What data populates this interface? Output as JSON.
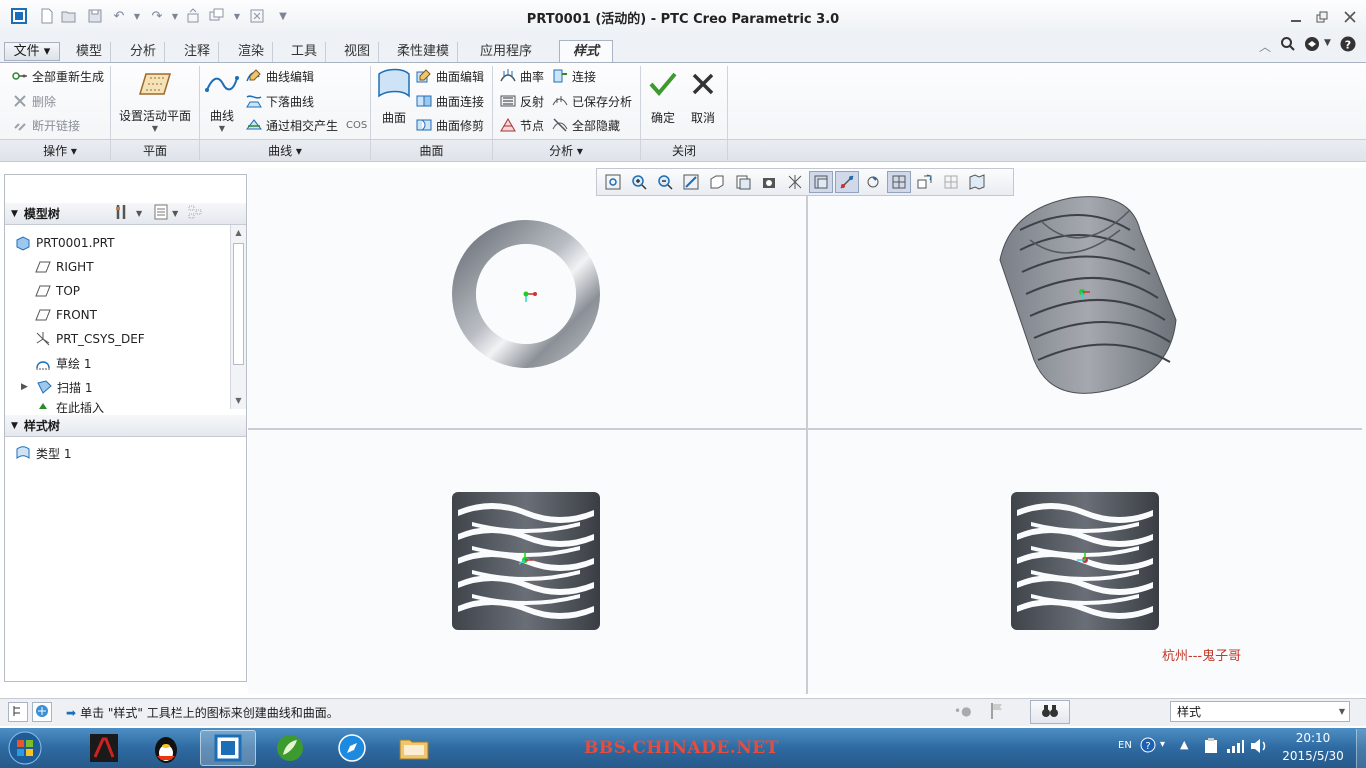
{
  "window": {
    "title": "PRT0001 (活动的) - PTC Creo Parametric 3.0"
  },
  "tabs": {
    "file": "文件",
    "items": [
      "模型",
      "分析",
      "注释",
      "渲染",
      "工具",
      "视图",
      "柔性建模",
      "应用程序"
    ],
    "active": "样式"
  },
  "ribbon": {
    "ops": {
      "regen": "全部重新生成",
      "delete": "删除",
      "break_link": "断开链接",
      "label": "操作"
    },
    "plane": {
      "set_active": "设置活动平面",
      "label": "平面"
    },
    "curve": {
      "curve": "曲线",
      "edit": "曲线编辑",
      "drop": "下落曲线",
      "cos": "通过相交产生",
      "cos_suffix": "COS",
      "label": "曲线"
    },
    "surface": {
      "surface": "曲面",
      "edit": "曲面编辑",
      "connect": "曲面连接",
      "trim": "曲面修剪",
      "label": "曲面"
    },
    "analysis": {
      "curvature": "曲率",
      "reflect": "反射",
      "node": "节点",
      "connect": "连接",
      "saved": "已保存分析",
      "hide_all": "全部隐藏",
      "label": "分析"
    },
    "close": {
      "ok": "确定",
      "cancel": "取消",
      "label": "关闭"
    }
  },
  "left_panel": {
    "model_tree_title": "模型树",
    "items": [
      "PRT0001.PRT",
      "RIGHT",
      "TOP",
      "FRONT",
      "PRT_CSYS_DEF",
      "草绘 1",
      "扫描 1",
      "在此插入"
    ],
    "style_tree_title": "样式树",
    "style_items": [
      "类型 1"
    ]
  },
  "viewport": {
    "watermark": "杭州---鬼子哥"
  },
  "status": {
    "message": "单击 \"样式\" 工具栏上的图标来创建曲线和曲面。",
    "filter_value": "样式"
  },
  "taskbar": {
    "banner": "BBS.CHINADE.NET",
    "lang": "EN",
    "time": "20:10",
    "date": "2015/5/30"
  },
  "colors": {
    "accent": "#1c6fb7",
    "ok_green": "#3c9a2e",
    "watermark_red": "#c0392b",
    "banner_red": "#e74c3c"
  }
}
